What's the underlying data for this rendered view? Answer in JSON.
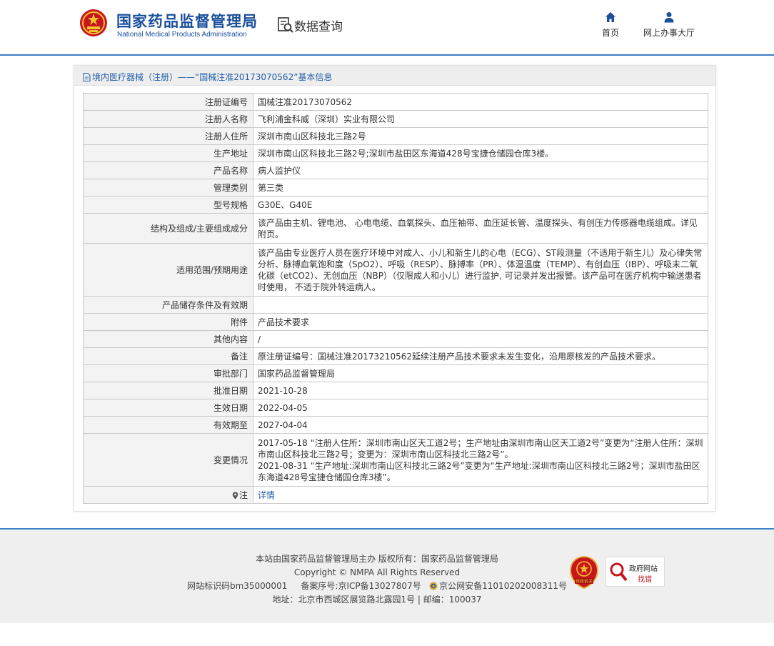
{
  "header": {
    "site_name_cn": "国家药品监督管理局",
    "site_name_en": "National Medical Products Administration",
    "data_query": "数据查询",
    "nav": {
      "home": "首页",
      "service_hall": "网上办事大厅"
    }
  },
  "panel": {
    "title": "境内医疗器械（注册）——“国械注准20173070562”基本信息"
  },
  "rows": [
    {
      "label": "注册证编号",
      "value": "国械注准20173070562"
    },
    {
      "label": "注册人名称",
      "value": "飞利浦金科威（深圳）实业有限公司"
    },
    {
      "label": "注册人住所",
      "value": "深圳市南山区科技北三路2号"
    },
    {
      "label": "生产地址",
      "value": "深圳市南山区科技北三路2号;深圳市盐田区东海道428号宝捷仓储园仓库3楼。"
    },
    {
      "label": "产品名称",
      "value": "病人监护仪"
    },
    {
      "label": "管理类别",
      "value": "第三类"
    },
    {
      "label": "型号规格",
      "value": "G30E、G40E"
    },
    {
      "label": "结构及组成/主要组成成分",
      "value": "该产品由主机、锂电池、 心电电缆、血氧探头、血压袖带、血压延长管、温度探头、有创压力传感器电缆组成。详见附页。"
    },
    {
      "label": "适用范围/预期用途",
      "value": "该产品由专业医疗人员在医疗环境中对成人、小儿和新生儿的心电（ECG）、ST段测量（不适用于新生儿）及心律失常分析、脉搏血氧饱和度（SpO2）、呼吸（RESP）、脉搏率（PR）、体温温度（TEMP）、有创血压（IBP）、呼吸末二氧化碳（etCO2）、无创血压（NBP）（仅限成人和小儿）进行监护, 可记录并发出报警。该产品可在医疗机构中输送患者时使用， 不适于院外转运病人。"
    },
    {
      "label": "产品储存条件及有效期",
      "value": ""
    },
    {
      "label": "附件",
      "value": "产品技术要求"
    },
    {
      "label": "其他内容",
      "value": "/"
    },
    {
      "label": "备注",
      "value": "原注册证编号：国械注准20173210562延续注册产品技术要求未发生变化，沿用原核发的产品技术要求。"
    },
    {
      "label": "审批部门",
      "value": "国家药品监督管理局"
    },
    {
      "label": "批准日期",
      "value": "2021-10-28"
    },
    {
      "label": "生效日期",
      "value": "2022-04-05"
    },
    {
      "label": "有效期至",
      "value": "2027-04-04"
    }
  ],
  "changes": {
    "label": "变更情况",
    "entries": [
      "2017-05-18 “注册人住所：深圳市南山区天工道2号；生产地址由深圳市南山区天工道2号”变更为“注册人住所：深圳市南山区科技北三路2号；变更为：深圳市南山区科技北三路2号”。",
      "2021-08-31 “生产地址:深圳市南山区科技北三路2号”变更为“生产地址:深圳市南山区科技北三路2号；深圳市盐田区东海道428号宝捷仓储园仓库3楼”。"
    ]
  },
  "note": {
    "label": "注",
    "link": "详情"
  },
  "footer": {
    "line1": "本站由国家药品监督管理局主办 版权所有：国家药品监督管理局",
    "line2": "Copyright © NMPA All Rights Reserved",
    "site_id": "网站标识码bm35000001",
    "icp": "备案序号:京ICP备13027807号",
    "police": "京公网安备11010202008311号",
    "line4": "地址：北京市西城区展览路北露园1号 | 邮编：100037",
    "party_badge": "党政机关",
    "gov_badge_line1": "政府网站",
    "gov_badge_line2": "找错"
  },
  "colors": {
    "brand_blue": "#1a4f9c",
    "link_blue": "#1f5da8",
    "header_rule": "#3b7ec8",
    "label_bg": "#f3f3f3",
    "emblem_red": "#c8161d",
    "emblem_gold": "#f2c230"
  }
}
